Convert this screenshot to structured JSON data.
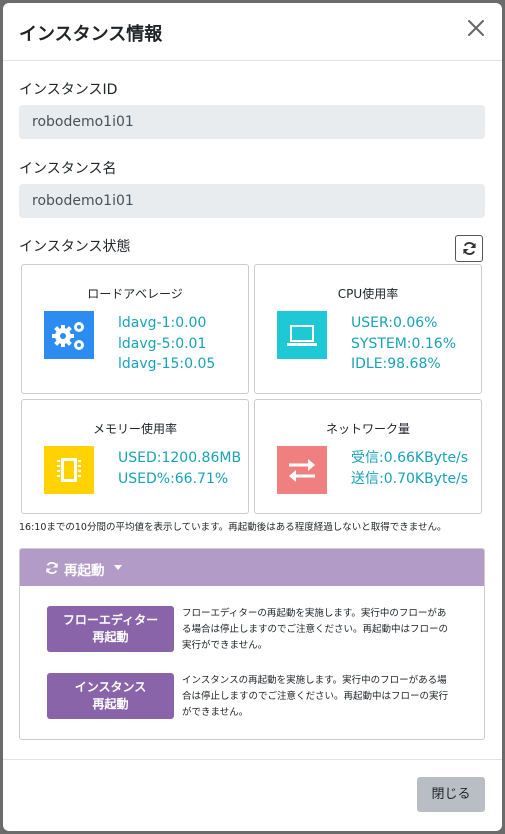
{
  "modal": {
    "title": "インスタンス情報"
  },
  "instance_id": {
    "label": "インスタンスID",
    "value": "robodemo1i01"
  },
  "instance_name": {
    "label": "インスタンス名",
    "value": "robodemo1i01"
  },
  "instance_status": {
    "label": "インスタンス状態"
  },
  "cards": {
    "load": {
      "title": "ロードアベレージ",
      "icon": "gears-icon",
      "color": "#2d8cf0",
      "lines": [
        "ldavg-1:0.00",
        "ldavg-5:0.01",
        "ldavg-15:0.05"
      ]
    },
    "cpu": {
      "title": "CPU使用率",
      "icon": "laptop-icon",
      "color": "#1ec8d4",
      "lines": [
        "USER:0.06%",
        "SYSTEM:0.16%",
        "IDLE:98.68%"
      ]
    },
    "memory": {
      "title": "メモリー使用率",
      "icon": "memory-chip-icon",
      "color": "#ffd200",
      "lines": [
        "USED:1200.86MB",
        "USED%:66.71%"
      ]
    },
    "network": {
      "title": "ネットワーク量",
      "icon": "exchange-arrows-icon",
      "color": "#f08080",
      "lines": [
        "受信:0.66KByte/s",
        "送信:0.70KByte/s"
      ]
    }
  },
  "note": "16:10までの10分間の平均値を表示しています。再起動後はある程度経過しないと取得できません。",
  "restart": {
    "header_label": "再起動",
    "flow_editor": {
      "button_line1": "フローエディター",
      "button_line2": "再起動",
      "desc": [
        "フローエディターの再起動を実施します。実行中のフローがあ",
        "る場合は停止しますのでご注意ください。再起動中はフローの",
        "実行ができません。"
      ]
    },
    "instance": {
      "button_line1": "インスタンス",
      "button_line2": "再起動",
      "desc": [
        "インスタンスの再起動を実施します。実行中のフローがある場",
        "合は停止しますのでご注意ください。再起動中はフローの実行",
        "ができません。"
      ]
    }
  },
  "footer": {
    "close_label": "閉じる"
  }
}
